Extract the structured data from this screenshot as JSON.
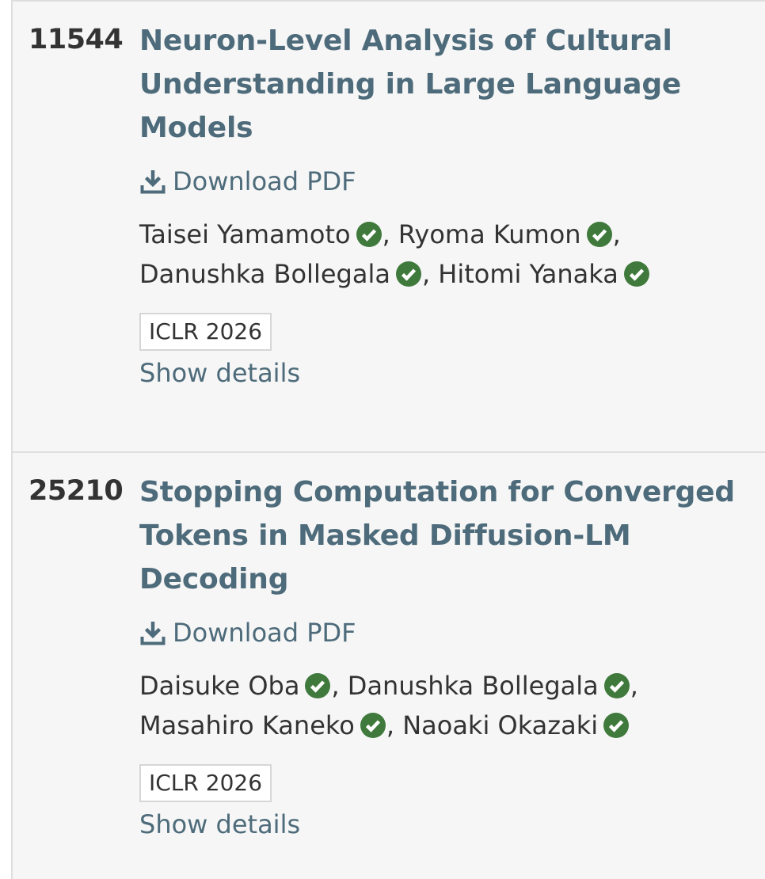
{
  "notes": [
    {
      "number": "11544",
      "title": "Neuron-Level Analysis of Cultural Understanding in Large Language Models",
      "download_label": "Download PDF",
      "authors": [
        {
          "name": "Taisei Yamamoto",
          "sep": ", "
        },
        {
          "name": "Ryoma Kumon",
          "sep": ","
        },
        {
          "name": "Danushka Bollegala",
          "sep": ", "
        },
        {
          "name": "Hitomi Yanaka",
          "sep": ""
        }
      ],
      "venue": "ICLR 2026",
      "details_label": "Show details"
    },
    {
      "number": "25210",
      "title": "Stopping Computation for Converged Tokens in Masked Diffusion-LM Decoding",
      "download_label": "Download PDF",
      "authors": [
        {
          "name": "Daisuke Oba",
          "sep": ", "
        },
        {
          "name": "Danushka Bollegala",
          "sep": ","
        },
        {
          "name": "Masahiro Kaneko",
          "sep": ", "
        },
        {
          "name": "Naoaki Okazaki",
          "sep": ""
        }
      ],
      "venue": "ICLR 2026",
      "details_label": "Show details"
    }
  ],
  "icons": {
    "download": "download-icon",
    "verified": "verified-check-icon"
  },
  "colors": {
    "link": "#4d6b7a",
    "verified": "#3f7a3c",
    "text": "#333333",
    "background": "#f6f6f6"
  }
}
